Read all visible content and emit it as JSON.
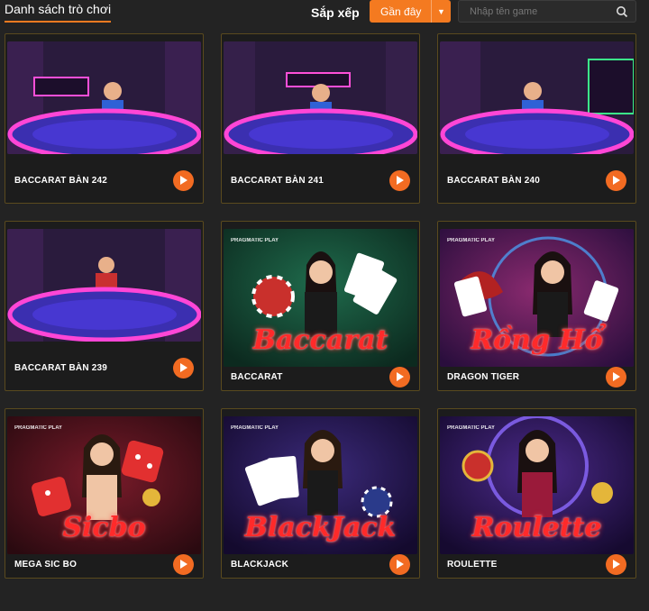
{
  "header": {
    "title": "Danh sách trò chơi",
    "sort_label": "Sắp xếp",
    "sort_value": "Gần đây",
    "search_placeholder": "Nhập tên game"
  },
  "games": [
    {
      "name": "BACCARAT BÀN 242"
    },
    {
      "name": "BACCARAT BÀN 241"
    },
    {
      "name": "BACCARAT BÀN 240"
    },
    {
      "name": "BACCARAT BÀN 239"
    },
    {
      "name": "BACCARAT",
      "poster_text": "Baccarat",
      "brand": "PRAGMATIC PLAY"
    },
    {
      "name": "DRAGON TIGER",
      "poster_text": "Rồng Hổ",
      "brand": "PRAGMATIC PLAY"
    },
    {
      "name": "MEGA SIC BO",
      "poster_text": "Sicbo",
      "brand": "PRAGMATIC PLAY"
    },
    {
      "name": "BLACKJACK",
      "poster_text": "BlackJack",
      "brand": "PRAGMATIC PLAY"
    },
    {
      "name": "ROULETTE",
      "poster_text": "Roulette",
      "brand": "PRAGMATIC PLAY"
    }
  ],
  "colors": {
    "accent": "#f47a20",
    "card_border": "#5a4a1e",
    "background": "#232323"
  }
}
